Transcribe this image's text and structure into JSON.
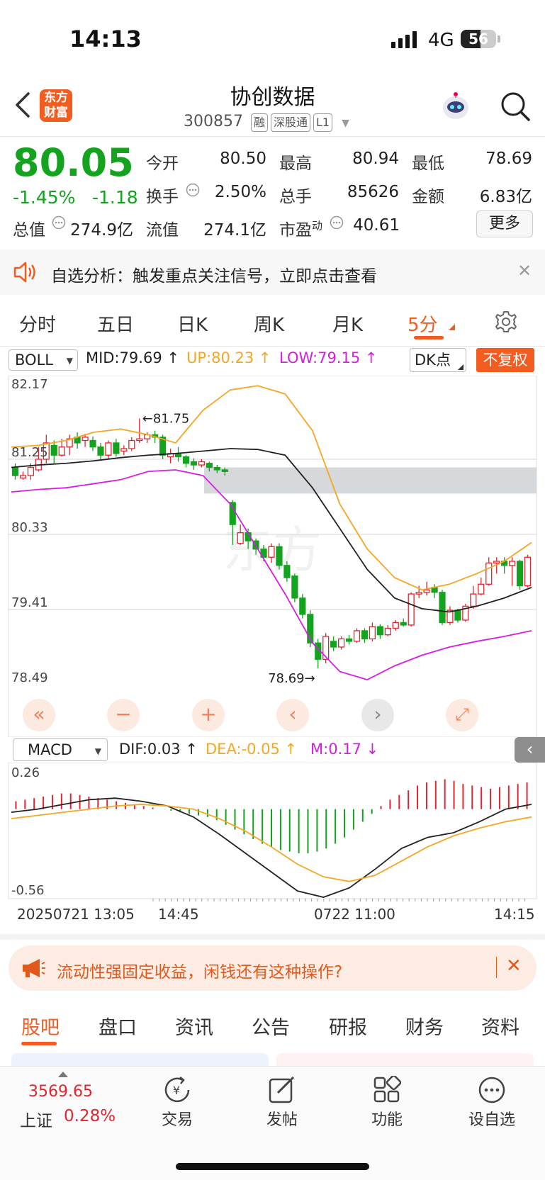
{
  "status_bar": {
    "time": "14:13",
    "network": "4G",
    "battery": "56",
    "battery_level": 0.56
  },
  "header": {
    "title": "协创数据",
    "code": "300857",
    "tags": [
      "融",
      "深股通",
      "L1"
    ],
    "logo_text_line1": "东方",
    "logo_text_line2": "财富"
  },
  "quote": {
    "price": "80.05",
    "change_pct": "-1.45%",
    "change": "-1.18",
    "open_label": "今开",
    "open": "80.50",
    "high_label": "最高",
    "high": "80.94",
    "low_label": "最低",
    "low": "78.69",
    "turnover_label": "换手",
    "turnover": "2.50%",
    "volume_label": "总手",
    "volume": "85626",
    "amount_label": "金额",
    "amount": "6.83亿",
    "mktcap_label": "总值",
    "mktcap": "274.9亿",
    "float_label": "流值",
    "float": "274.1亿",
    "pe_label": "市盈",
    "pe_sup": "动",
    "pe": "40.61",
    "more_label": "更多"
  },
  "banner": {
    "text": "自选分析：触发重点关注信号，立即点击查看"
  },
  "tabs": [
    "分时",
    "五日",
    "日K",
    "周K",
    "月K",
    "5分"
  ],
  "active_tab": "5分",
  "indicators": {
    "main": "BOLL",
    "mid": "MID:79.69",
    "up": "UP:80.23",
    "low": "LOW:79.15",
    "dk_label": "DK点",
    "fq_label": "不复权",
    "macd": "MACD",
    "dif": "DIF:0.03",
    "dea": "DEA:-0.05",
    "m": "M:0.17"
  },
  "colors": {
    "accent": "#f25c1f",
    "up": "#e0262f",
    "down": "#14a31e",
    "boll_up": "#f5a623",
    "boll_low": "#d71de0",
    "mid": "#222222"
  },
  "chart_data": [
    {
      "type": "candlestick",
      "y_labels": [
        "82.17",
        "81.25",
        "80.33",
        "79.41",
        "78.49"
      ],
      "ylim": [
        78.49,
        82.17
      ],
      "annotations": [
        {
          "text": "81.75",
          "arrow": "←"
        },
        {
          "text": "78.69",
          "arrow": "→"
        }
      ],
      "x_labels": [
        "20250721 13:05",
        "14:45",
        "0722 11:00",
        "14:15"
      ],
      "candles": [
        [
          81.15,
          81.05,
          81.2,
          81.0
        ],
        [
          81.02,
          81.05,
          81.1,
          81.0
        ],
        [
          81.05,
          81.15,
          81.2,
          81.0
        ],
        [
          81.12,
          81.25,
          81.4,
          81.1
        ],
        [
          81.25,
          81.45,
          81.55,
          81.2
        ],
        [
          81.42,
          81.3,
          81.48,
          81.2
        ],
        [
          81.3,
          81.4,
          81.5,
          81.28
        ],
        [
          81.4,
          81.5,
          81.55,
          81.3
        ],
        [
          81.52,
          81.45,
          81.58,
          81.38
        ],
        [
          81.48,
          81.52,
          81.56,
          81.4
        ],
        [
          81.48,
          81.4,
          81.53,
          81.35
        ],
        [
          81.4,
          81.3,
          81.45,
          81.25
        ],
        [
          81.3,
          81.45,
          81.48,
          81.25
        ],
        [
          81.45,
          81.32,
          81.5,
          81.28
        ],
        [
          81.35,
          81.38,
          81.42,
          81.3
        ],
        [
          81.38,
          81.48,
          81.52,
          81.35
        ],
        [
          81.48,
          81.5,
          81.75,
          81.45
        ],
        [
          81.5,
          81.55,
          81.58,
          81.45
        ],
        [
          81.55,
          81.52,
          81.6,
          81.45
        ],
        [
          81.52,
          81.3,
          81.55,
          81.25
        ],
        [
          81.28,
          81.32,
          81.38,
          81.2
        ],
        [
          81.32,
          81.28,
          81.4,
          81.22
        ],
        [
          81.28,
          81.2,
          81.3,
          81.15
        ],
        [
          81.22,
          81.18,
          81.26,
          81.12
        ],
        [
          81.18,
          81.22,
          81.25,
          81.15
        ],
        [
          81.2,
          81.15,
          81.22,
          81.1
        ],
        [
          81.15,
          81.12,
          81.18,
          81.08
        ],
        [
          81.12,
          81.1,
          81.15,
          81.05
        ],
        [
          80.72,
          80.45,
          80.75,
          80.2
        ],
        [
          80.22,
          80.35,
          80.45,
          80.2
        ],
        [
          80.35,
          80.25,
          80.4,
          80.15
        ],
        [
          80.25,
          80.15,
          80.28,
          80.08
        ],
        [
          80.15,
          80.05,
          80.2,
          80.0
        ],
        [
          80.05,
          80.18,
          80.22,
          79.98
        ],
        [
          80.18,
          79.95,
          80.22,
          79.9
        ],
        [
          79.95,
          79.8,
          80.0,
          79.75
        ],
        [
          79.82,
          79.55,
          79.85,
          79.5
        ],
        [
          79.55,
          79.35,
          79.6,
          79.3
        ],
        [
          79.35,
          79.0,
          79.4,
          78.95
        ],
        [
          79.0,
          78.8,
          79.05,
          78.69
        ],
        [
          78.8,
          79.08,
          79.12,
          78.75
        ],
        [
          79.02,
          78.95,
          79.08,
          78.9
        ],
        [
          78.95,
          79.05,
          79.08,
          78.92
        ],
        [
          79.05,
          79.02,
          79.1,
          78.98
        ],
        [
          79.02,
          79.15,
          79.18,
          79.0
        ],
        [
          79.15,
          79.05,
          79.18,
          79.0
        ],
        [
          79.05,
          79.2,
          79.25,
          79.02
        ],
        [
          79.2,
          79.1,
          79.23,
          79.05
        ],
        [
          79.1,
          79.18,
          79.22,
          79.08
        ],
        [
          79.18,
          79.25,
          79.28,
          79.15
        ],
        [
          79.25,
          79.22,
          79.3,
          79.2
        ],
        [
          79.22,
          79.6,
          79.62,
          79.2
        ],
        [
          79.6,
          79.62,
          79.7,
          79.55
        ],
        [
          79.62,
          79.65,
          79.75,
          79.58
        ],
        [
          79.68,
          79.62,
          79.72,
          79.55
        ],
        [
          79.62,
          79.25,
          79.65,
          79.22
        ],
        [
          79.25,
          79.4,
          79.45,
          79.22
        ],
        [
          79.4,
          79.28,
          79.42,
          79.25
        ],
        [
          79.28,
          79.45,
          79.48,
          79.26
        ],
        [
          79.45,
          79.6,
          79.7,
          79.42
        ],
        [
          79.6,
          79.72,
          79.8,
          79.58
        ],
        [
          79.72,
          79.98,
          80.05,
          79.7
        ],
        [
          79.98,
          80.0,
          80.05,
          79.85
        ],
        [
          80.0,
          79.95,
          80.05,
          79.85
        ],
        [
          79.95,
          80.0,
          80.05,
          79.7
        ],
        [
          80.0,
          79.7,
          80.02,
          79.65
        ],
        [
          79.7,
          80.05,
          80.08,
          79.68
        ]
      ],
      "series": [
        {
          "name": "MID",
          "values": [
            81.15,
            81.18,
            81.2,
            81.23,
            81.27,
            81.3,
            81.32,
            81.35,
            81.38,
            81.37,
            81.3,
            80.9,
            80.4,
            79.9,
            79.55,
            79.42,
            79.38,
            79.45,
            79.55,
            79.68
          ]
        },
        {
          "name": "UP",
          "values": [
            81.4,
            81.42,
            81.48,
            81.58,
            81.62,
            81.55,
            81.45,
            81.85,
            82.1,
            82.15,
            82.05,
            81.6,
            80.7,
            80.15,
            79.8,
            79.65,
            79.72,
            79.85,
            80.0,
            80.23
          ]
        },
        {
          "name": "LOW",
          "values": [
            80.85,
            80.88,
            80.9,
            80.95,
            81.0,
            81.1,
            81.12,
            81.05,
            80.7,
            80.15,
            79.6,
            79.0,
            78.65,
            78.55,
            78.72,
            78.85,
            78.95,
            79.02,
            79.08,
            79.15
          ]
        }
      ]
    },
    {
      "type": "bar",
      "title": "MACD",
      "y_labels": [
        "0.26",
        "-0.56"
      ],
      "ylim": [
        -0.56,
        0.26
      ],
      "values": [
        0.05,
        0.06,
        0.07,
        0.08,
        0.09,
        0.1,
        0.1,
        0.09,
        0.08,
        0.07,
        0.06,
        0.05,
        0.04,
        0.03,
        0.02,
        0.01,
        0.0,
        -0.01,
        -0.02,
        -0.03,
        -0.04,
        -0.05,
        -0.07,
        -0.1,
        -0.13,
        -0.16,
        -0.19,
        -0.22,
        -0.24,
        -0.26,
        -0.27,
        -0.28,
        -0.28,
        -0.27,
        -0.25,
        -0.22,
        -0.18,
        -0.13,
        -0.08,
        -0.03,
        0.02,
        0.06,
        0.09,
        0.12,
        0.15,
        0.17,
        0.18,
        0.19,
        0.18,
        0.16,
        0.15,
        0.14,
        0.13,
        0.14,
        0.15,
        0.16,
        0.17
      ],
      "series": [
        {
          "name": "DIF",
          "values": [
            -0.02,
            0.0,
            0.03,
            0.06,
            0.07,
            0.05,
            0.02,
            -0.05,
            -0.16,
            -0.28,
            -0.4,
            -0.52,
            -0.56,
            -0.5,
            -0.38,
            -0.25,
            -0.18,
            -0.15,
            -0.08,
            0.0,
            0.03
          ]
        },
        {
          "name": "DEA",
          "values": [
            -0.06,
            -0.04,
            -0.02,
            0.0,
            0.02,
            0.03,
            0.02,
            0.0,
            -0.06,
            -0.14,
            -0.24,
            -0.35,
            -0.43,
            -0.46,
            -0.42,
            -0.33,
            -0.24,
            -0.17,
            -0.12,
            -0.08,
            -0.05
          ]
        }
      ]
    }
  ],
  "controls": {
    "rewind": "«",
    "zoom_out": "−",
    "zoom_in": "+",
    "prev": "‹",
    "next": "›",
    "expand": "⤢"
  },
  "promo": {
    "text": "流动性强固定收益，闲钱还有这种操作?"
  },
  "subtabs": [
    "股吧",
    "盘口",
    "资讯",
    "公告",
    "研报",
    "财务",
    "资料"
  ],
  "active_subtab": "股吧",
  "bottom_nav": {
    "index_value": "3569.65",
    "index_name": "上证",
    "index_change": "0.28%",
    "items": [
      "交易",
      "发帖",
      "功能",
      "设自选"
    ]
  }
}
